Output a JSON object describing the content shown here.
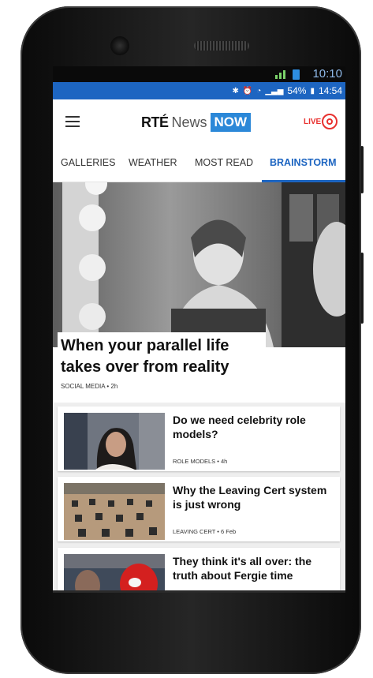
{
  "outer_status": {
    "time": "10:10"
  },
  "status_bar": {
    "battery": "54%",
    "time": "14:54"
  },
  "app": {
    "logo_rte": "RTÉ",
    "logo_news": "News",
    "logo_now": "NOW",
    "live_label": "LIVE"
  },
  "tabs": [
    {
      "label": "GALLERIES"
    },
    {
      "label": "WEATHER"
    },
    {
      "label": "MOST READ"
    },
    {
      "label": "BRAINSTORM"
    }
  ],
  "hero": {
    "title": "When your parallel life takes over from reality",
    "meta": "SOCIAL MEDIA • 2h"
  },
  "articles": [
    {
      "title": "Do we need celebrity role models?",
      "meta": "ROLE MODELS • 4h"
    },
    {
      "title": "Why the Leaving Cert system is just wrong",
      "meta": "LEAVING CERT • 6 Feb"
    },
    {
      "title": "They think it's all over: the truth about Fergie time",
      "meta": ""
    }
  ],
  "colors": {
    "brand_blue": "#1d65c1",
    "now_blue": "#2b88d8",
    "live_red": "#e8312f"
  }
}
